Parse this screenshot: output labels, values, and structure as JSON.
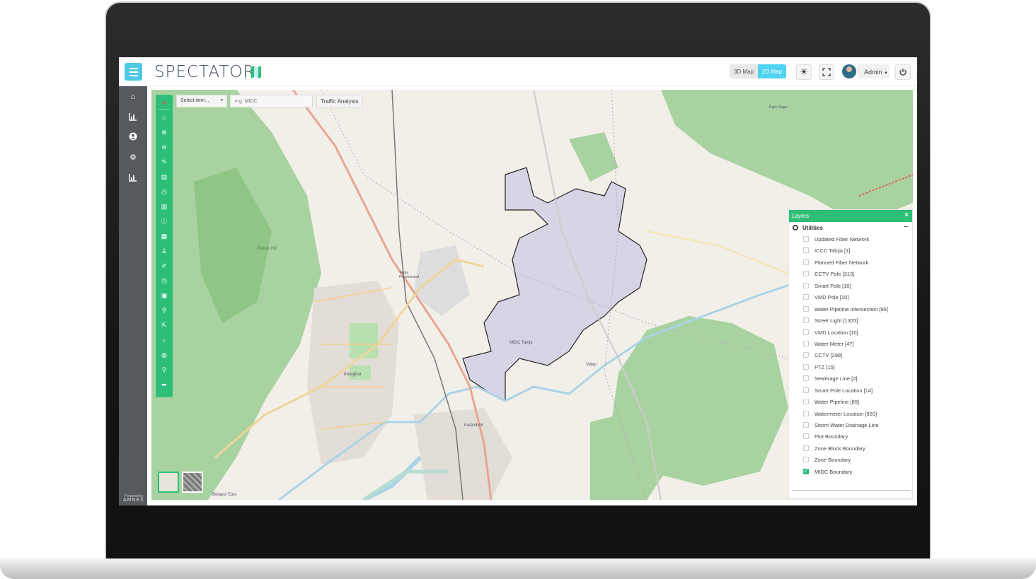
{
  "header": {
    "brand": "SPECTATOR",
    "map_3d_label": "3D Map",
    "map_2d_label": "2D Map",
    "active_map": "2D Map",
    "user_label": "Admin",
    "accent_color": "#4fd3f0"
  },
  "sidebar": {
    "items": [
      {
        "icon": "home-icon"
      },
      {
        "icon": "chart-icon"
      },
      {
        "icon": "user-icon"
      },
      {
        "icon": "gears-icon"
      },
      {
        "icon": "chart-icon"
      }
    ],
    "powered_by": "Powered by",
    "company": "AMNEX"
  },
  "map_toolbar": {
    "select_placeholder": "Select item...",
    "search_placeholder": "e.g. MIDC",
    "traffic_button": "Traffic Analysis",
    "tool_color": "#2dbf77"
  },
  "map_labels": {
    "parsik_hill": "Parsik Hill",
    "taloja_panchanand": "Taloja Panchanand",
    "kalamboli": "Kalamboli",
    "kharghar": "Kharghar",
    "midc_taloja": "MIDC Taloja",
    "valap": "Valap",
    "belapur": "Belapur East",
    "rajiv": "Rajiv Nagar"
  },
  "layers": {
    "title": "Layers",
    "group": "Utilities",
    "items": [
      {
        "label": "Updated Fiber Network",
        "checked": false
      },
      {
        "label": "ICCC Taloja [1]",
        "checked": false
      },
      {
        "label": "Planned Fiber Network",
        "checked": false
      },
      {
        "label": "CCTV Pole [313]",
        "checked": false
      },
      {
        "label": "Smart Pole [10]",
        "checked": false
      },
      {
        "label": "VMD Pole [10]",
        "checked": false
      },
      {
        "label": "Water Pipeline Intersection [96]",
        "checked": false
      },
      {
        "label": "Street Light [1325]",
        "checked": false
      },
      {
        "label": "VMD Location [10]",
        "checked": false
      },
      {
        "label": "Water Meter [47]",
        "checked": false
      },
      {
        "label": "CCTV [298]",
        "checked": false
      },
      {
        "label": "PTZ [15]",
        "checked": false
      },
      {
        "label": "Sewerage Line [2]",
        "checked": false
      },
      {
        "label": "Smart Pole Location [14]",
        "checked": false
      },
      {
        "label": "Water Pipeline [89]",
        "checked": false
      },
      {
        "label": "Watermeter Location [920]",
        "checked": false
      },
      {
        "label": "Storm Water Drainage Line",
        "checked": false
      },
      {
        "label": "Plot Boundary",
        "checked": false
      },
      {
        "label": "Zone Block Boundary",
        "checked": false
      },
      {
        "label": "Zone Boundary",
        "checked": false
      },
      {
        "label": "MIDC Boundary",
        "checked": true
      }
    ]
  }
}
